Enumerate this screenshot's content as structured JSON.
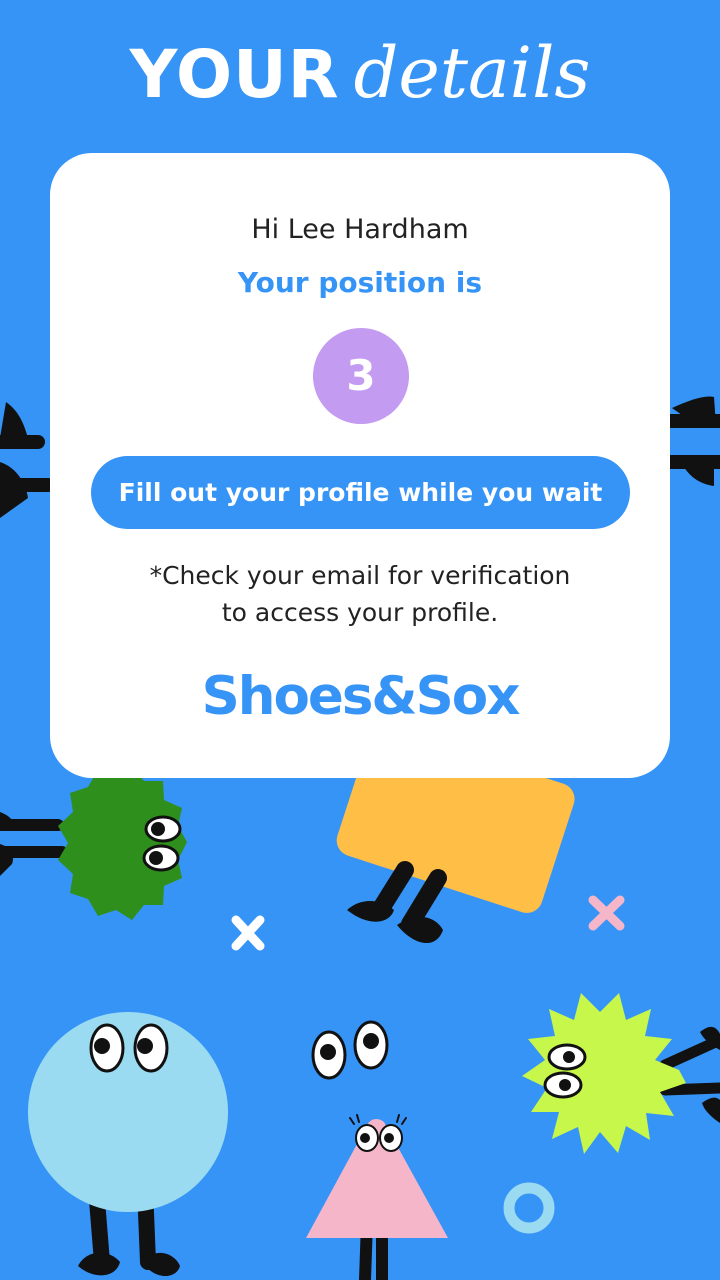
{
  "header": {
    "title_strong": "YOUR",
    "title_emphasis": "details"
  },
  "card": {
    "greeting": "Hi Lee Hardham",
    "position_label": "Your position is",
    "position_value": "3",
    "cta_label": "Fill out your profile while you wait",
    "note_line1": "*Check your email for verification",
    "note_line2": "to access your profile.",
    "logo_text": "Shoes&Sox"
  },
  "colors": {
    "background": "#3694f7",
    "card": "#ffffff",
    "accent_blue": "#3694f7",
    "badge_purple": "#c39bf0",
    "yellow_shape": "#ffbe46",
    "green_shape": "#2e8f1d",
    "light_blue_shape": "#9adbf2",
    "lime_shape": "#c7f74a",
    "pink_shape": "#f4b6c8"
  },
  "icons": [
    "yellow-rectangle-character-icon",
    "green-fuzzy-character-icon",
    "light-blue-circle-character-icon",
    "pink-triangle-character-icon",
    "lime-starburst-character-icon",
    "floating-eyes-icon",
    "x-mark-icon",
    "ring-icon",
    "character-legs-icon"
  ]
}
